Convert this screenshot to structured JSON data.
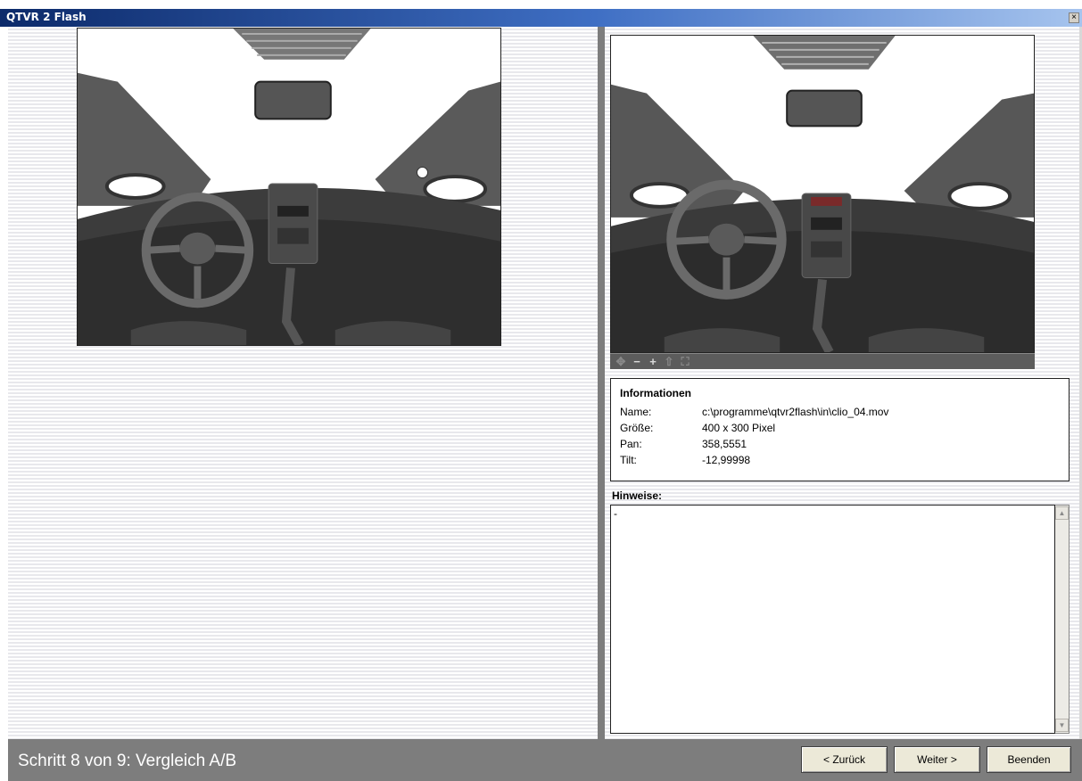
{
  "window": {
    "title": "QTVR 2 Flash",
    "close_glyph": "×"
  },
  "preview_b": {
    "controls": [
      {
        "glyph": "✥",
        "icon": "pan-icon",
        "dim": true
      },
      {
        "glyph": "−",
        "icon": "zoom-out-icon",
        "dim": false
      },
      {
        "glyph": "+",
        "icon": "zoom-in-icon",
        "dim": false
      },
      {
        "glyph": "⇧",
        "icon": "hotspot-icon",
        "dim": true
      },
      {
        "glyph": "⛶",
        "icon": "fullscreen-icon",
        "dim": true
      }
    ]
  },
  "info": {
    "title": "Informationen",
    "rows": [
      {
        "key": "Name:",
        "value": "c:\\programme\\qtvr2flash\\in\\clio_04.mov"
      },
      {
        "key": "Größe:",
        "value": "400 x 300 Pixel"
      },
      {
        "key": "Pan:",
        "value": "358,5551"
      },
      {
        "key": "Tilt:",
        "value": "-12,99998"
      }
    ]
  },
  "hints": {
    "label": "Hinweise:",
    "text": "-"
  },
  "footer": {
    "step": "Schritt 8 von 9: Vergleich A/B",
    "back_label": "< Zurück",
    "next_label": "Weiter >",
    "finish_label": "Beenden"
  }
}
